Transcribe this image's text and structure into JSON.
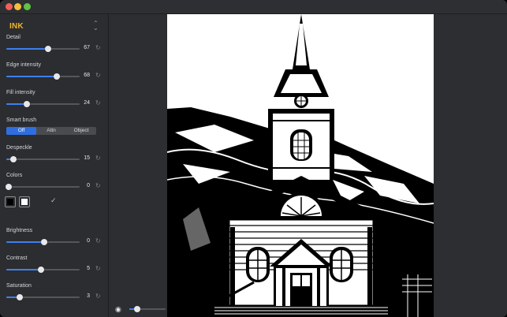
{
  "filter": {
    "name": "INK",
    "accent": "#f0b429"
  },
  "sliders": {
    "detail": {
      "label": "Detail",
      "value": "67",
      "fraction": 0.57
    },
    "edge": {
      "label": "Edge intensity",
      "value": "68",
      "fraction": 0.69
    },
    "fill": {
      "label": "Fill intensity",
      "value": "24",
      "fraction": 0.28
    },
    "despeckle": {
      "label": "Despeckle",
      "value": "15",
      "fraction": 0.1
    },
    "colors": {
      "label": "Colors",
      "value": "0",
      "fraction": 0.03
    },
    "brightness": {
      "label": "Brightness",
      "value": "0",
      "fraction": 0.52
    },
    "contrast": {
      "label": "Contrast",
      "value": "5",
      "fraction": 0.47
    },
    "saturation": {
      "label": "Saturation",
      "value": "3",
      "fraction": 0.18
    }
  },
  "smart_brush": {
    "label": "Smart brush",
    "options": [
      "Off",
      "Attn",
      "Object"
    ],
    "selected": "Off"
  },
  "swatches": {
    "dark": "#000000",
    "light": "#ffffff",
    "check": "✓"
  },
  "icons": {
    "reset": "↻",
    "chevron": "⌃⌄",
    "eye": "👁"
  },
  "zoom": {
    "fraction": 0.22
  },
  "accent_colors": {
    "slider": "#3d7ff0",
    "selected_segment": "#2f6ee0"
  }
}
